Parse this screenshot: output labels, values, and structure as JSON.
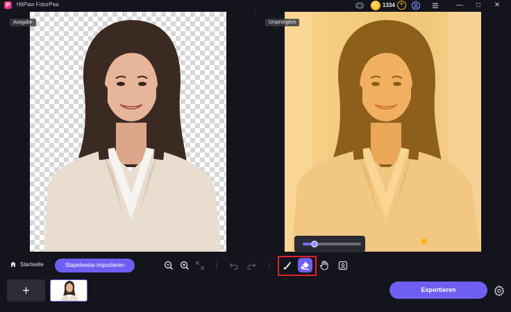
{
  "app": {
    "title": "HitPaw FotorPea",
    "logo_letter": "P"
  },
  "header": {
    "credits": "1334",
    "add_credits_symbol": "+"
  },
  "window_controls": {
    "minimize": "—",
    "maximize": "□",
    "close": "✕"
  },
  "panes": {
    "output_label": "Ausgabe",
    "original_label": "Ursprünglich"
  },
  "toolbar": {
    "home_label": "Startseite",
    "batch_import_label": "Stapelweise importieren",
    "icons": [
      "zoom-out-icon",
      "zoom-in-icon",
      "fit-screen-icon",
      "undo-icon",
      "redo-icon",
      "brush-icon",
      "eraser-icon",
      "hand-icon",
      "compare-icon"
    ]
  },
  "brush_size_slider": {
    "value_fraction": 0.2
  },
  "bottom": {
    "add_symbol": "+",
    "export_label": "Exportieren"
  },
  "colors": {
    "accent": "#6f5ff0",
    "highlight": "#e0222d",
    "background": "#14141c",
    "coin": "#f5b623"
  }
}
